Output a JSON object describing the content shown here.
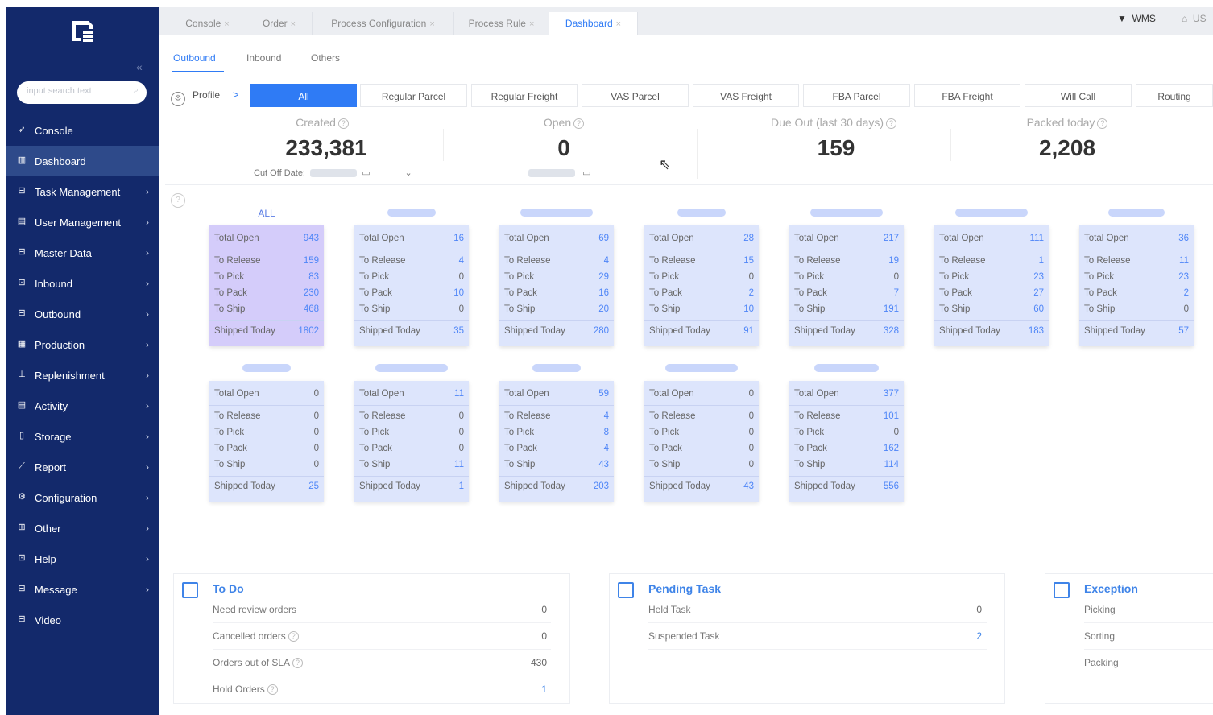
{
  "sidebar": {
    "search_placeholder": "input search text",
    "items": [
      {
        "label": "Console",
        "icon": "send-icon",
        "active": false,
        "arrow": false
      },
      {
        "label": "Dashboard",
        "icon": "chart-icon",
        "active": true,
        "arrow": false
      },
      {
        "label": "Task Management",
        "icon": "lock-icon",
        "active": false,
        "arrow": true
      },
      {
        "label": "User Management",
        "icon": "users-icon",
        "active": false,
        "arrow": true
      },
      {
        "label": "Master Data",
        "icon": "lock-icon",
        "active": false,
        "arrow": true
      },
      {
        "label": "Inbound",
        "icon": "inbound-icon",
        "active": false,
        "arrow": true
      },
      {
        "label": "Outbound",
        "icon": "outbound-icon",
        "active": false,
        "arrow": true
      },
      {
        "label": "Production",
        "icon": "production-icon",
        "active": false,
        "arrow": true
      },
      {
        "label": "Replenishment",
        "icon": "replenish-icon",
        "active": false,
        "arrow": true
      },
      {
        "label": "Activity",
        "icon": "activity-icon",
        "active": false,
        "arrow": true
      },
      {
        "label": "Storage",
        "icon": "storage-icon",
        "active": false,
        "arrow": true
      },
      {
        "label": "Report",
        "icon": "report-icon",
        "active": false,
        "arrow": true
      },
      {
        "label": "Configuration",
        "icon": "gear-icon",
        "active": false,
        "arrow": true
      },
      {
        "label": "Other",
        "icon": "other-icon",
        "active": false,
        "arrow": true
      },
      {
        "label": "Help",
        "icon": "help-icon",
        "active": false,
        "arrow": true
      },
      {
        "label": "Message",
        "icon": "lock-icon",
        "active": false,
        "arrow": true
      },
      {
        "label": "Video",
        "icon": "lock-icon",
        "active": false,
        "arrow": false
      }
    ]
  },
  "tabs": [
    {
      "label": "Console",
      "active": false
    },
    {
      "label": "Order",
      "active": false
    },
    {
      "label": "Process Configuration",
      "active": false
    },
    {
      "label": "Process Rule",
      "active": false
    },
    {
      "label": "Dashboard",
      "active": true
    }
  ],
  "header": {
    "wms": "WMS",
    "user": "US"
  },
  "subtabs": [
    {
      "label": "Outbound",
      "active": true
    },
    {
      "label": "Inbound",
      "active": false
    },
    {
      "label": "Others",
      "active": false
    }
  ],
  "profile_label": "Profile",
  "categories": [
    "All",
    "Regular Parcel",
    "Regular Freight",
    "VAS Parcel",
    "VAS Freight",
    "FBA Parcel",
    "FBA Freight",
    "Will Call",
    "Routing"
  ],
  "kpis": {
    "created": {
      "label": "Created",
      "value": "233,381"
    },
    "open": {
      "label": "Open",
      "value": "0"
    },
    "due_out": {
      "label": "Due Out  (last 30 days)",
      "value": "159"
    },
    "packed": {
      "label": "Packed today",
      "value": "2,208"
    },
    "cutoff_label": "Cut Off Date:"
  },
  "card_labels": {
    "total_open": "Total Open",
    "to_release": "To Release",
    "to_pick": "To Pick",
    "to_pack": "To Pack",
    "to_ship": "To Ship",
    "shipped_today": "Shipped Today"
  },
  "cards": [
    {
      "title": "ALL",
      "total_open": "943",
      "to_release": "159",
      "to_pick": "83",
      "to_pack": "230",
      "to_ship": "468",
      "shipped_today": "1802"
    },
    {
      "title": "",
      "total_open": "16",
      "to_release": "4",
      "to_pick": "0",
      "to_pack": "10",
      "to_ship": "0",
      "shipped_today": "35"
    },
    {
      "title": "",
      "total_open": "69",
      "to_release": "4",
      "to_pick": "29",
      "to_pack": "16",
      "to_ship": "20",
      "shipped_today": "280"
    },
    {
      "title": "",
      "total_open": "28",
      "to_release": "15",
      "to_pick": "0",
      "to_pack": "2",
      "to_ship": "10",
      "shipped_today": "91"
    },
    {
      "title": "",
      "total_open": "217",
      "to_release": "19",
      "to_pick": "0",
      "to_pack": "7",
      "to_ship": "191",
      "shipped_today": "328"
    },
    {
      "title": "",
      "total_open": "111",
      "to_release": "1",
      "to_pick": "23",
      "to_pack": "27",
      "to_ship": "60",
      "shipped_today": "183"
    },
    {
      "title": "",
      "total_open": "36",
      "to_release": "11",
      "to_pick": "23",
      "to_pack": "2",
      "to_ship": "0",
      "shipped_today": "57"
    },
    {
      "title": "",
      "total_open": "0",
      "to_release": "0",
      "to_pick": "0",
      "to_pack": "0",
      "to_ship": "0",
      "shipped_today": "25"
    },
    {
      "title": "",
      "total_open": "11",
      "to_release": "0",
      "to_pick": "0",
      "to_pack": "0",
      "to_ship": "11",
      "shipped_today": "1"
    },
    {
      "title": "",
      "total_open": "59",
      "to_release": "4",
      "to_pick": "8",
      "to_pack": "4",
      "to_ship": "43",
      "shipped_today": "203"
    },
    {
      "title": "",
      "total_open": "0",
      "to_release": "0",
      "to_pick": "0",
      "to_pack": "0",
      "to_ship": "0",
      "shipped_today": "43"
    },
    {
      "title": "",
      "total_open": "377",
      "to_release": "101",
      "to_pick": "0",
      "to_pack": "162",
      "to_ship": "114",
      "shipped_today": "556"
    }
  ],
  "todo": {
    "title": "To Do",
    "rows": [
      {
        "label": "Need review orders",
        "value": "0"
      },
      {
        "label": "Cancelled orders",
        "value": "0"
      },
      {
        "label": "Orders out of SLA",
        "value": "430"
      },
      {
        "label": "Hold Orders",
        "value": "1"
      }
    ]
  },
  "pending": {
    "title": "Pending Task",
    "rows": [
      {
        "label": "Held Task",
        "value": "0"
      },
      {
        "label": "Suspended Task",
        "value": "2"
      }
    ]
  },
  "exception": {
    "title": "Exception",
    "rows": [
      {
        "label": "Picking"
      },
      {
        "label": "Sorting"
      },
      {
        "label": "Packing"
      }
    ]
  },
  "colors": {
    "sidebar": "#13296b",
    "accent": "#2f7bf5",
    "card": "#dde5fc",
    "card_all": "#d4ccfa"
  }
}
